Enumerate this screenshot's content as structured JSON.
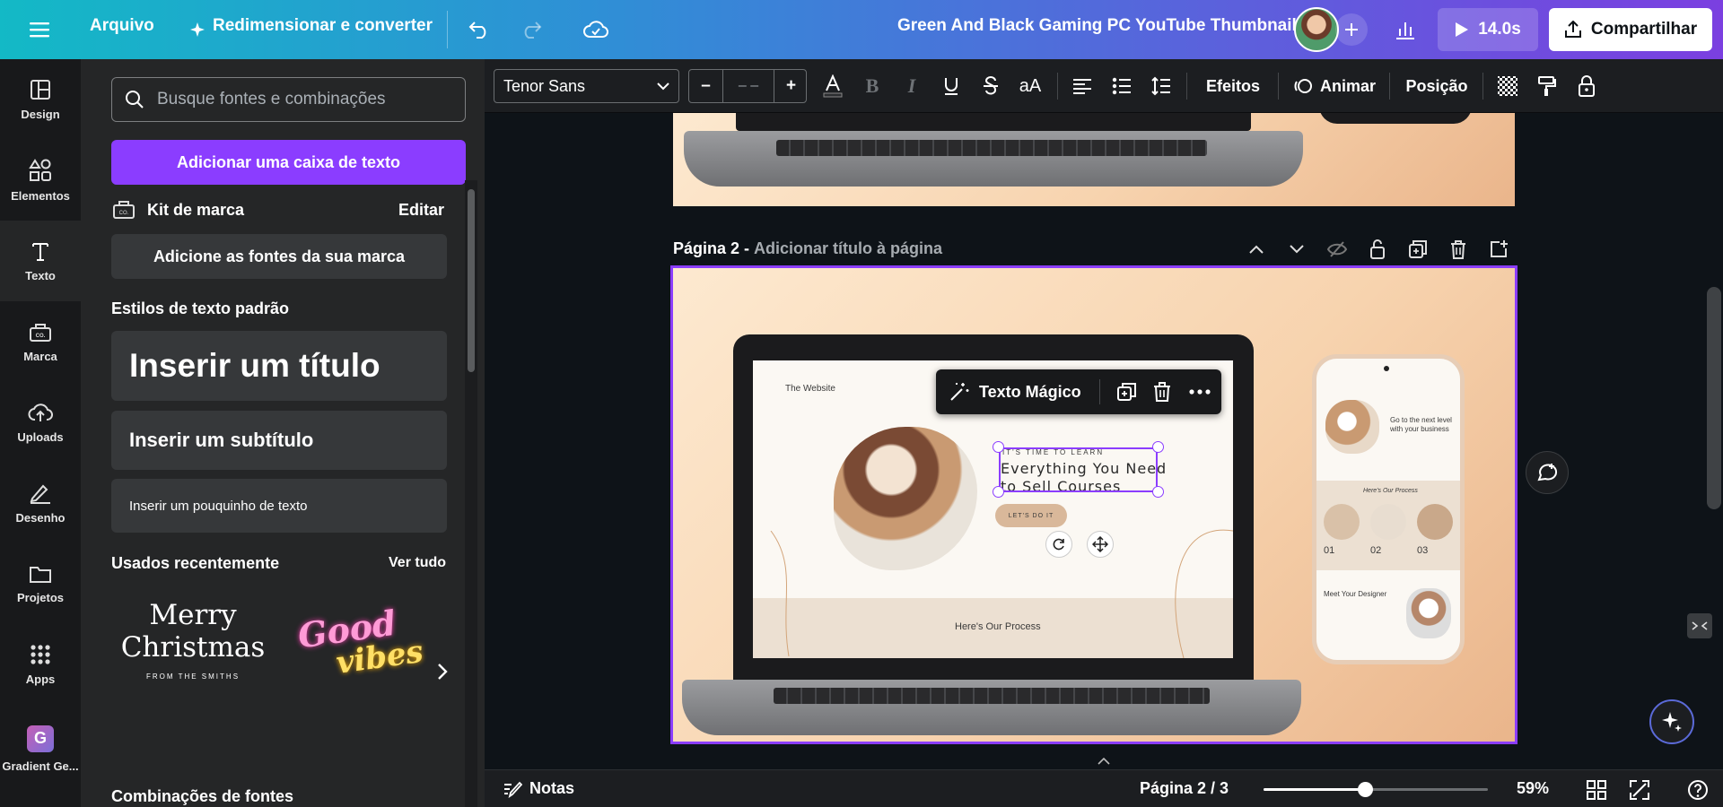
{
  "topbar": {
    "file_menu": "Arquivo",
    "resize_label": "Redimensionar e converter",
    "design_title": "Green And Black Gaming PC YouTube Thumbnail",
    "play_duration": "14.0s",
    "share_label": "Compartilhar"
  },
  "rail": {
    "items": [
      {
        "label": "Design",
        "icon": "layout-icon"
      },
      {
        "label": "Elementos",
        "icon": "shapes-icon"
      },
      {
        "label": "Texto",
        "icon": "text-icon"
      },
      {
        "label": "Marca",
        "icon": "brand-icon"
      },
      {
        "label": "Uploads",
        "icon": "cloud-upload-icon"
      },
      {
        "label": "Desenho",
        "icon": "pen-icon"
      },
      {
        "label": "Projetos",
        "icon": "folder-icon"
      },
      {
        "label": "Apps",
        "icon": "apps-grid-icon"
      },
      {
        "label": "Gradient Ge...",
        "icon": "gradient-app-icon"
      }
    ]
  },
  "panel": {
    "search_placeholder": "Busque fontes e combinações",
    "add_textbox": "Adicionar uma caixa de texto",
    "brand_kit": "Kit de marca",
    "edit": "Editar",
    "add_brand_fonts": "Adicione as fontes da sua marca",
    "default_styles": "Estilos de texto padrão",
    "insert_title": "Inserir um título",
    "insert_subtitle": "Inserir um subtítulo",
    "insert_body": "Inserir um pouquinho de texto",
    "recently_used": "Usados recentemente",
    "see_all": "Ver tudo",
    "recent_1_line1": "Merry",
    "recent_1_line2": "Christmas",
    "recent_1_small": "FROM THE SMITHS",
    "recent_2_line1": "Good",
    "recent_2_line2": "vibes",
    "font_combos": "Combinações de fontes"
  },
  "toolbar": {
    "font_family": "Tenor Sans",
    "minus": "–",
    "font_size": "– –",
    "plus": "+",
    "effects": "Efeitos",
    "animate": "Animar",
    "position": "Posição"
  },
  "canvas": {
    "page2_label": "Página 2 -",
    "page2_add_title": "Adicionar título à página",
    "magic_text": "Texto Mágico",
    "mock": {
      "site_title": "The Website",
      "time_to_learn": "IT'S TIME TO LEARN",
      "headline_line1": "Everything You Need",
      "headline_line2": "to Sell Courses",
      "cta": "LET'S DO IT",
      "process": "Here's Our Process",
      "phone_next_level_1": "Go to the next level",
      "phone_next_level_2": "with your business",
      "phone_process": "Here's Our Process",
      "phone_step_1": "01",
      "phone_step_2": "02",
      "phone_step_3": "03",
      "phone_meet": "Meet Your Designer"
    }
  },
  "bottombar": {
    "notes": "Notas",
    "page_indicator": "Página 2 / 3",
    "zoom": "59%",
    "zoom_fraction": 0.45
  },
  "colors": {
    "accent": "#8b3dff",
    "panel_bg": "#252627",
    "rail_bg": "#18191b"
  }
}
